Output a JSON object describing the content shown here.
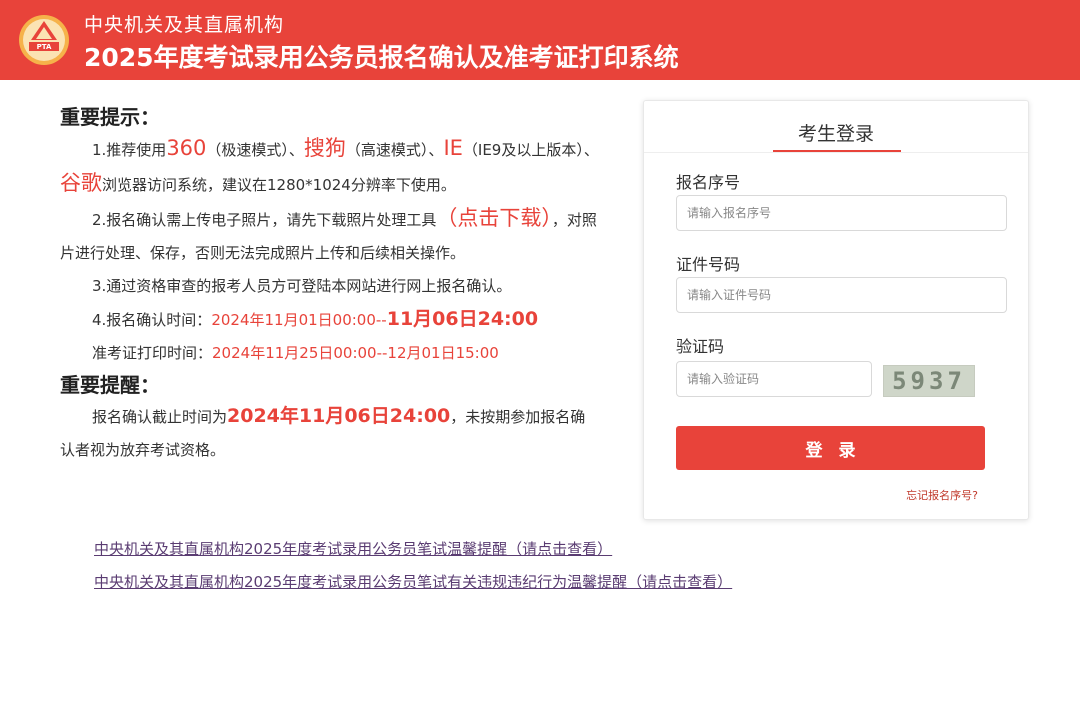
{
  "colors": {
    "brand_red": "#e8433a",
    "link_purple": "#5a3c72"
  },
  "header": {
    "logo_text": "PTA",
    "line1": "中央机关及其直属机构",
    "line2": "2025年度考试录用公务员报名确认及准考证打印系统"
  },
  "notice": {
    "title": "重要提示：",
    "item1": {
      "t1": "1.推荐使用",
      "b1": "360",
      "t2": "（极速模式）、",
      "b2": "搜狗",
      "t3": "（高速模式）、",
      "b3": "IE",
      "t4": "（IE9及以上版本）、",
      "b4": "谷歌",
      "t5": "浏览器访问系统，建议在1280*1024分辨率下使用。"
    },
    "item2": {
      "t1": "2.报名确认需上传电子照片，请先下载照片处理工具",
      "link": "（点击下载）",
      "t2": "，对照片进行处理、保存，否则无法完成照片上传和后续相关操作。"
    },
    "item3": "3.通过资格审查的报考人员方可登陆本网站进行网上报名确认。",
    "item4": {
      "label": "4.报名确认时间：",
      "start": "2024年11月01日00:00--",
      "end": "11月06日24:00"
    },
    "item5": {
      "label": "准考证打印时间：",
      "value": "2024年11月25日00:00--12月01日15:00"
    }
  },
  "reminder": {
    "title": "重要提醒：",
    "t1": "报名确认截止时间为",
    "deadline": "2024年11月06日24:00",
    "t2": "，未按期参加报名确认者视为放弃考试资格。"
  },
  "login": {
    "title": "考生登录",
    "reg_label": "报名序号",
    "reg_placeholder": "请输入报名序号",
    "id_label": "证件号码",
    "id_placeholder": "请输入证件号码",
    "captcha_label": "验证码",
    "captcha_placeholder": "请输入验证码",
    "captcha_text": "5937",
    "button": "登录",
    "forgot": "忘记报名序号?"
  },
  "links": [
    "中央机关及其直属机构2025年度考试录用公务员笔试温馨提醒（请点击查看）",
    "中央机关及其直属机构2025年度考试录用公务员笔试有关违规违纪行为温馨提醒（请点击查看）"
  ]
}
